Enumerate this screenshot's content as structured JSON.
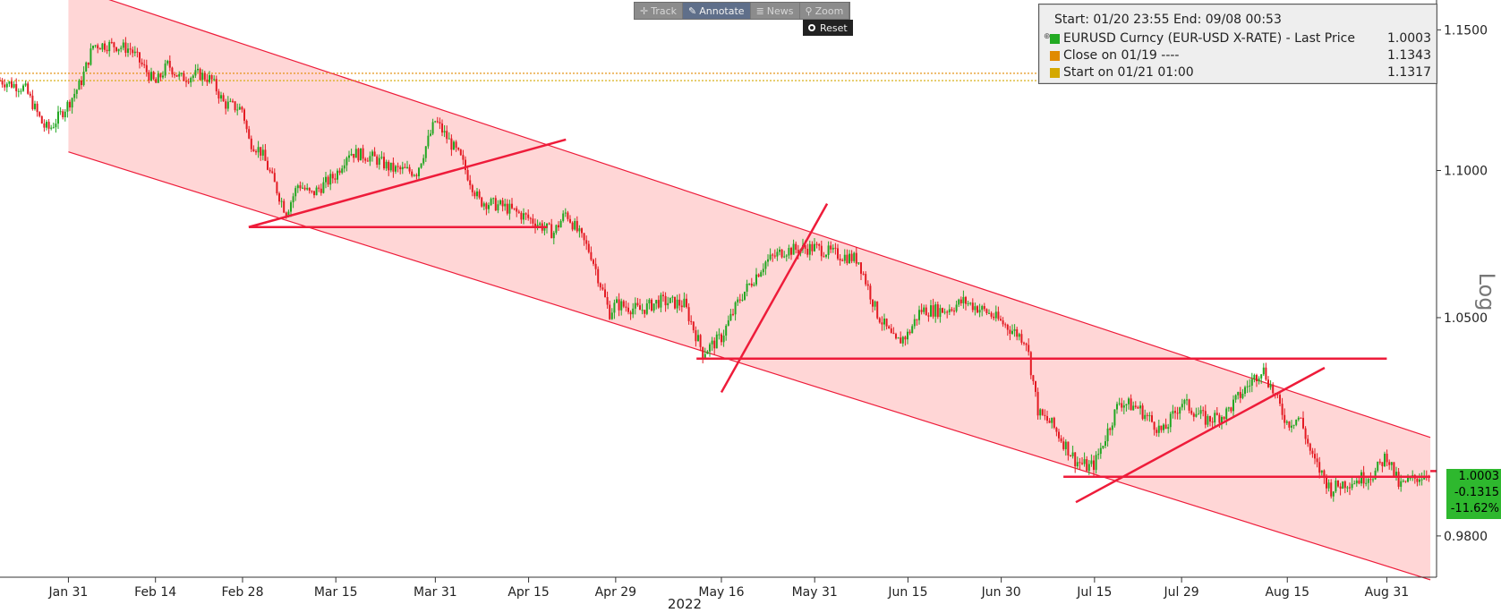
{
  "toolbar": {
    "buttons": [
      {
        "label": "Track",
        "icon": "crosshair-icon",
        "glyph": "✛",
        "active": false
      },
      {
        "label": "Annotate",
        "icon": "pencil-icon",
        "glyph": "✎",
        "active": true
      },
      {
        "label": "News",
        "icon": "news-icon",
        "glyph": "≣",
        "active": false
      },
      {
        "label": "Zoom",
        "icon": "magnifier-icon",
        "glyph": "⚲",
        "active": false
      }
    ],
    "reset_label": "Reset"
  },
  "legend": {
    "title": "Start: 01/20 23:55 End: 09/08 00:53",
    "rows": [
      {
        "label": "EURUSD Curncy (EUR-USD X-RATE) - Last Price",
        "value": "1.0003",
        "color": "#22aa22"
      },
      {
        "label": "Close on 01/19 ----",
        "value": "1.1343",
        "color": "#e08a00"
      },
      {
        "label": "Start on 01/21 01:00",
        "value": "1.1317",
        "color": "#d4a800"
      }
    ]
  },
  "last_value_box": {
    "price": "1.0003",
    "change": "-0.1315",
    "pct": "-11.62%"
  },
  "colors": {
    "up_candle": "#22a722",
    "down_candle": "#e31b23",
    "channel_fill": "#ffc8c8",
    "trend_line": "#ee1c3a",
    "close_ref": "#e08a00",
    "start_ref": "#d4a800",
    "last_box": "#2eb82e"
  },
  "chart_data": {
    "type": "line",
    "title": "",
    "xlabel": "2022",
    "ylabel": "Log",
    "y_scale": "log",
    "ylim": [
      0.9673,
      1.1609
    ],
    "xlim": [
      "2022-01-20",
      "2022-09-08"
    ],
    "y_ticks": [
      1.15,
      1.1,
      1.05,
      0.98
    ],
    "y_tick_labels": [
      "1.1500",
      "1.1000",
      "1.0500",
      "0.9800"
    ],
    "x_tick_labels": [
      "Jan 31",
      "Feb 14",
      "Feb 28",
      "Mar 15",
      "Mar 31",
      "Apr 15",
      "Apr 29",
      "May 16",
      "May 31",
      "Jun 15",
      "Jun 30",
      "Jul 15",
      "Jul 29",
      "Aug 15",
      "Aug 31"
    ],
    "x_ticks": [
      "2022-01-31",
      "2022-02-14",
      "2022-02-28",
      "2022-03-15",
      "2022-03-31",
      "2022-04-15",
      "2022-04-29",
      "2022-05-16",
      "2022-05-31",
      "2022-06-15",
      "2022-06-30",
      "2022-07-15",
      "2022-07-29",
      "2022-08-15",
      "2022-08-31"
    ],
    "year_label": "2022",
    "series": [
      {
        "name": "EURUSD Curncy (EUR-USD X-RATE) - Last Price",
        "x": [
          "2022-01-20",
          "2022-01-24",
          "2022-01-27",
          "2022-01-28",
          "2022-01-31",
          "2022-02-02",
          "2022-02-04",
          "2022-02-07",
          "2022-02-10",
          "2022-02-14",
          "2022-02-16",
          "2022-02-18",
          "2022-02-21",
          "2022-02-23",
          "2022-02-25",
          "2022-02-28",
          "2022-03-01",
          "2022-03-03",
          "2022-03-07",
          "2022-03-09",
          "2022-03-11",
          "2022-03-15",
          "2022-03-17",
          "2022-03-21",
          "2022-03-24",
          "2022-03-28",
          "2022-03-31",
          "2022-04-04",
          "2022-04-07",
          "2022-04-11",
          "2022-04-15",
          "2022-04-19",
          "2022-04-21",
          "2022-04-25",
          "2022-04-28",
          "2022-04-29",
          "2022-05-03",
          "2022-05-06",
          "2022-05-10",
          "2022-05-13",
          "2022-05-16",
          "2022-05-19",
          "2022-05-23",
          "2022-05-26",
          "2022-05-31",
          "2022-06-03",
          "2022-06-07",
          "2022-06-10",
          "2022-06-13",
          "2022-06-15",
          "2022-06-17",
          "2022-06-21",
          "2022-06-24",
          "2022-06-28",
          "2022-06-30",
          "2022-07-04",
          "2022-07-06",
          "2022-07-08",
          "2022-07-12",
          "2022-07-14",
          "2022-07-15",
          "2022-07-19",
          "2022-07-22",
          "2022-07-26",
          "2022-07-29",
          "2022-08-02",
          "2022-08-05",
          "2022-08-09",
          "2022-08-11",
          "2022-08-15",
          "2022-08-17",
          "2022-08-19",
          "2022-08-22",
          "2022-08-24",
          "2022-08-26",
          "2022-08-29",
          "2022-08-31",
          "2022-09-02",
          "2022-09-07"
        ],
        "values": [
          1.1317,
          1.129,
          1.1155,
          1.1145,
          1.1235,
          1.131,
          1.1445,
          1.1445,
          1.143,
          1.1305,
          1.1375,
          1.1325,
          1.134,
          1.132,
          1.1235,
          1.1215,
          1.1105,
          1.1065,
          1.0855,
          1.0955,
          1.0915,
          1.0985,
          1.1065,
          1.1045,
          1.1005,
          1.0995,
          1.1175,
          1.1045,
          1.0895,
          1.0875,
          1.0835,
          1.0785,
          1.0855,
          1.0715,
          1.0515,
          1.0545,
          1.0525,
          1.0555,
          1.0545,
          1.0385,
          1.0435,
          1.0565,
          1.0685,
          1.0725,
          1.0735,
          1.0715,
          1.0695,
          1.0515,
          1.0415,
          1.0445,
          1.0525,
          1.0525,
          1.0555,
          1.0515,
          1.0485,
          1.0425,
          1.0185,
          1.0155,
          1.0035,
          1.0015,
          1.0025,
          1.0225,
          1.0205,
          1.0125,
          1.0225,
          1.0165,
          1.0185,
          1.0285,
          1.0335,
          1.0155,
          1.0175,
          1.0045,
          0.9945,
          0.9965,
          0.9975,
          0.9995,
          1.0055,
          0.9955,
          1.0003
        ]
      }
    ],
    "reference_lines": [
      {
        "label": "Close on 01/19",
        "value": 1.1343
      },
      {
        "label": "Start on 01/21 01:00",
        "value": 1.1317
      }
    ],
    "channel": {
      "upper": [
        [
          "2022-01-31",
          1.166
        ],
        [
          "2022-09-07",
          1.011
        ]
      ],
      "lower": [
        [
          "2022-01-31",
          1.1065
        ],
        [
          "2022-09-07",
          0.9665
        ]
      ]
    },
    "annotations": [
      {
        "type": "line",
        "points": [
          [
            "2022-03-01",
            1.0805
          ],
          [
            "2022-04-18",
            1.0805
          ]
        ]
      },
      {
        "type": "line",
        "points": [
          [
            "2022-03-01",
            1.0805
          ],
          [
            "2022-04-21",
            1.1108
          ]
        ]
      },
      {
        "type": "line",
        "points": [
          [
            "2022-05-12",
            1.0365
          ],
          [
            "2022-08-31",
            1.0365
          ]
        ]
      },
      {
        "type": "line",
        "points": [
          [
            "2022-05-16",
            1.0255
          ],
          [
            "2022-06-02",
            1.0885
          ]
        ]
      },
      {
        "type": "line",
        "points": [
          [
            "2022-07-10",
            0.9985
          ],
          [
            "2022-09-07",
            0.9985
          ]
        ]
      },
      {
        "type": "line",
        "points": [
          [
            "2022-07-12",
            0.9905
          ],
          [
            "2022-08-21",
            1.0335
          ]
        ]
      }
    ]
  }
}
